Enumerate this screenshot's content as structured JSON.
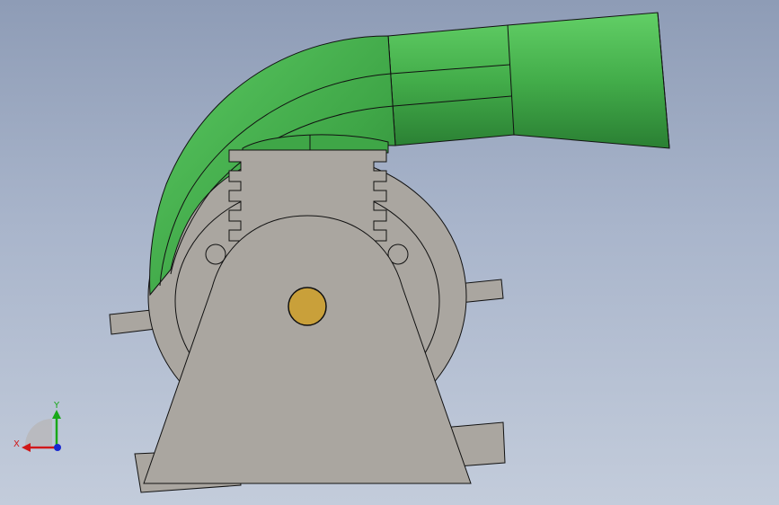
{
  "window": {
    "view": "model-viewport"
  },
  "triad": {
    "x_label": "X",
    "y_label": "Y",
    "colors": {
      "x": "#d01818",
      "y": "#18a818",
      "z": "#1828d0"
    }
  },
  "model": {
    "colors": {
      "housing": "#aaa6a0",
      "pipe": "#4fbb55",
      "pipe_shade": "#2f8a38",
      "shaft": "#c9a03a",
      "edge": "#111111",
      "background_top": "#8e9cb6",
      "background_bottom": "#c3ccdb"
    }
  }
}
